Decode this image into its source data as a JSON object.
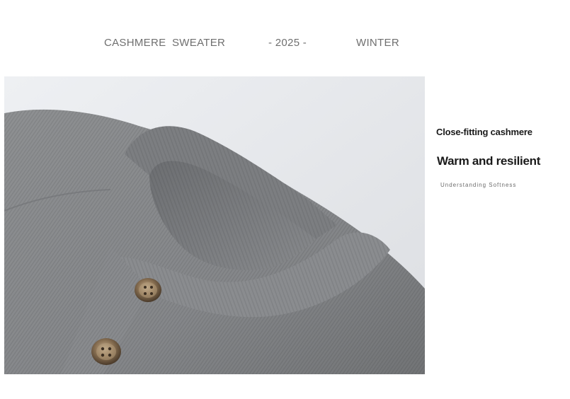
{
  "header": {
    "word1": "CASHMERE",
    "word2": "SWEATER",
    "year": "-  2025 -",
    "season": "WINTER"
  },
  "photo": {
    "subject": "grey-knit-cardigan-collar-with-buttons"
  },
  "side": {
    "line1": "Close-fitting cashmere",
    "line2": "Warm and resilient",
    "line3": "Understanding Softness"
  },
  "colors": {
    "knit": "#8a8c8e",
    "background": "#e9eaed",
    "button": "#6e5a44",
    "header_text": "#6f6f6f"
  }
}
